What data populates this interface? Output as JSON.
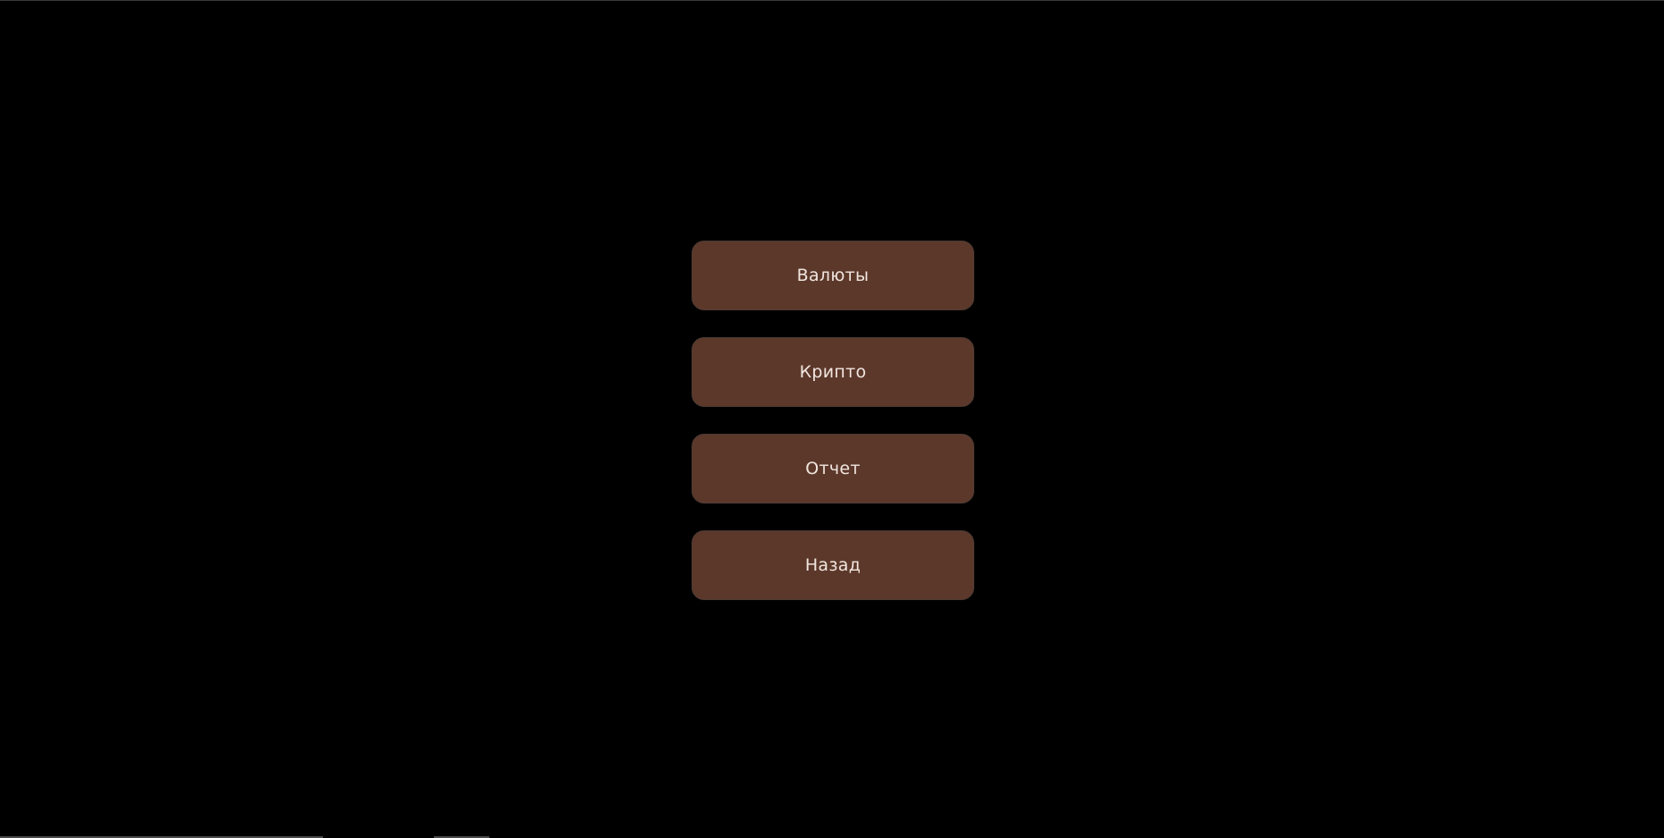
{
  "menu": {
    "items": [
      {
        "label": "Валюты"
      },
      {
        "label": "Крипто"
      },
      {
        "label": "Отчет"
      },
      {
        "label": "Назад"
      }
    ]
  },
  "colors": {
    "background": "#000000",
    "button_bg": "#5c382b",
    "button_text": "#f1e6df",
    "button_border": "#4a3a33"
  }
}
